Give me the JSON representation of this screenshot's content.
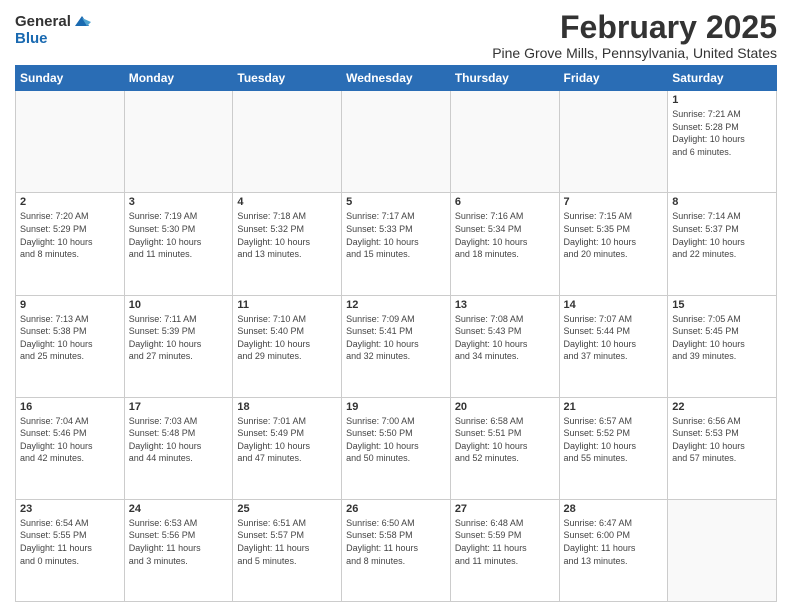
{
  "logo": {
    "general": "General",
    "blue": "Blue"
  },
  "title": {
    "month": "February 2025",
    "location": "Pine Grove Mills, Pennsylvania, United States"
  },
  "weekdays": [
    "Sunday",
    "Monday",
    "Tuesday",
    "Wednesday",
    "Thursday",
    "Friday",
    "Saturday"
  ],
  "weeks": [
    [
      {
        "day": "",
        "info": ""
      },
      {
        "day": "",
        "info": ""
      },
      {
        "day": "",
        "info": ""
      },
      {
        "day": "",
        "info": ""
      },
      {
        "day": "",
        "info": ""
      },
      {
        "day": "",
        "info": ""
      },
      {
        "day": "1",
        "info": "Sunrise: 7:21 AM\nSunset: 5:28 PM\nDaylight: 10 hours\nand 6 minutes."
      }
    ],
    [
      {
        "day": "2",
        "info": "Sunrise: 7:20 AM\nSunset: 5:29 PM\nDaylight: 10 hours\nand 8 minutes."
      },
      {
        "day": "3",
        "info": "Sunrise: 7:19 AM\nSunset: 5:30 PM\nDaylight: 10 hours\nand 11 minutes."
      },
      {
        "day": "4",
        "info": "Sunrise: 7:18 AM\nSunset: 5:32 PM\nDaylight: 10 hours\nand 13 minutes."
      },
      {
        "day": "5",
        "info": "Sunrise: 7:17 AM\nSunset: 5:33 PM\nDaylight: 10 hours\nand 15 minutes."
      },
      {
        "day": "6",
        "info": "Sunrise: 7:16 AM\nSunset: 5:34 PM\nDaylight: 10 hours\nand 18 minutes."
      },
      {
        "day": "7",
        "info": "Sunrise: 7:15 AM\nSunset: 5:35 PM\nDaylight: 10 hours\nand 20 minutes."
      },
      {
        "day": "8",
        "info": "Sunrise: 7:14 AM\nSunset: 5:37 PM\nDaylight: 10 hours\nand 22 minutes."
      }
    ],
    [
      {
        "day": "9",
        "info": "Sunrise: 7:13 AM\nSunset: 5:38 PM\nDaylight: 10 hours\nand 25 minutes."
      },
      {
        "day": "10",
        "info": "Sunrise: 7:11 AM\nSunset: 5:39 PM\nDaylight: 10 hours\nand 27 minutes."
      },
      {
        "day": "11",
        "info": "Sunrise: 7:10 AM\nSunset: 5:40 PM\nDaylight: 10 hours\nand 29 minutes."
      },
      {
        "day": "12",
        "info": "Sunrise: 7:09 AM\nSunset: 5:41 PM\nDaylight: 10 hours\nand 32 minutes."
      },
      {
        "day": "13",
        "info": "Sunrise: 7:08 AM\nSunset: 5:43 PM\nDaylight: 10 hours\nand 34 minutes."
      },
      {
        "day": "14",
        "info": "Sunrise: 7:07 AM\nSunset: 5:44 PM\nDaylight: 10 hours\nand 37 minutes."
      },
      {
        "day": "15",
        "info": "Sunrise: 7:05 AM\nSunset: 5:45 PM\nDaylight: 10 hours\nand 39 minutes."
      }
    ],
    [
      {
        "day": "16",
        "info": "Sunrise: 7:04 AM\nSunset: 5:46 PM\nDaylight: 10 hours\nand 42 minutes."
      },
      {
        "day": "17",
        "info": "Sunrise: 7:03 AM\nSunset: 5:48 PM\nDaylight: 10 hours\nand 44 minutes."
      },
      {
        "day": "18",
        "info": "Sunrise: 7:01 AM\nSunset: 5:49 PM\nDaylight: 10 hours\nand 47 minutes."
      },
      {
        "day": "19",
        "info": "Sunrise: 7:00 AM\nSunset: 5:50 PM\nDaylight: 10 hours\nand 50 minutes."
      },
      {
        "day": "20",
        "info": "Sunrise: 6:58 AM\nSunset: 5:51 PM\nDaylight: 10 hours\nand 52 minutes."
      },
      {
        "day": "21",
        "info": "Sunrise: 6:57 AM\nSunset: 5:52 PM\nDaylight: 10 hours\nand 55 minutes."
      },
      {
        "day": "22",
        "info": "Sunrise: 6:56 AM\nSunset: 5:53 PM\nDaylight: 10 hours\nand 57 minutes."
      }
    ],
    [
      {
        "day": "23",
        "info": "Sunrise: 6:54 AM\nSunset: 5:55 PM\nDaylight: 11 hours\nand 0 minutes."
      },
      {
        "day": "24",
        "info": "Sunrise: 6:53 AM\nSunset: 5:56 PM\nDaylight: 11 hours\nand 3 minutes."
      },
      {
        "day": "25",
        "info": "Sunrise: 6:51 AM\nSunset: 5:57 PM\nDaylight: 11 hours\nand 5 minutes."
      },
      {
        "day": "26",
        "info": "Sunrise: 6:50 AM\nSunset: 5:58 PM\nDaylight: 11 hours\nand 8 minutes."
      },
      {
        "day": "27",
        "info": "Sunrise: 6:48 AM\nSunset: 5:59 PM\nDaylight: 11 hours\nand 11 minutes."
      },
      {
        "day": "28",
        "info": "Sunrise: 6:47 AM\nSunset: 6:00 PM\nDaylight: 11 hours\nand 13 minutes."
      },
      {
        "day": "",
        "info": ""
      }
    ]
  ]
}
